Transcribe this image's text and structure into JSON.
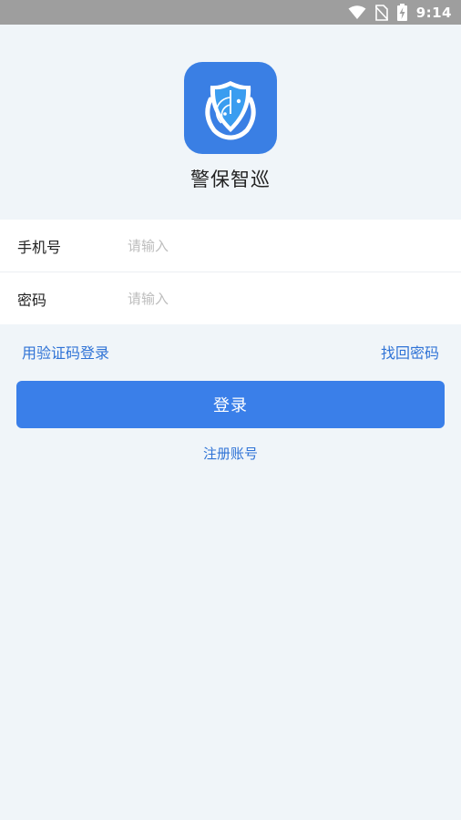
{
  "status_bar": {
    "time": "9:14",
    "icons": [
      "wifi-icon",
      "no-sim-icon",
      "battery-charging-icon"
    ]
  },
  "app": {
    "name": "警保智巡",
    "logo_icon": "police-radar-shield-icon",
    "logo_color": "#3a7fe4"
  },
  "form": {
    "phone_label": "手机号",
    "phone_placeholder": "请输入",
    "phone_value": "",
    "password_label": "密码",
    "password_placeholder": "请输入",
    "password_value": ""
  },
  "links": {
    "sms_login": "用验证码登录",
    "forgot_password": "找回密码",
    "register": "注册账号"
  },
  "login_button": {
    "label": "登录"
  },
  "colors": {
    "accent": "#3a7fe9",
    "link": "#2f73d6",
    "background": "#f0f5f9",
    "status_bar": "#9e9e9e"
  }
}
